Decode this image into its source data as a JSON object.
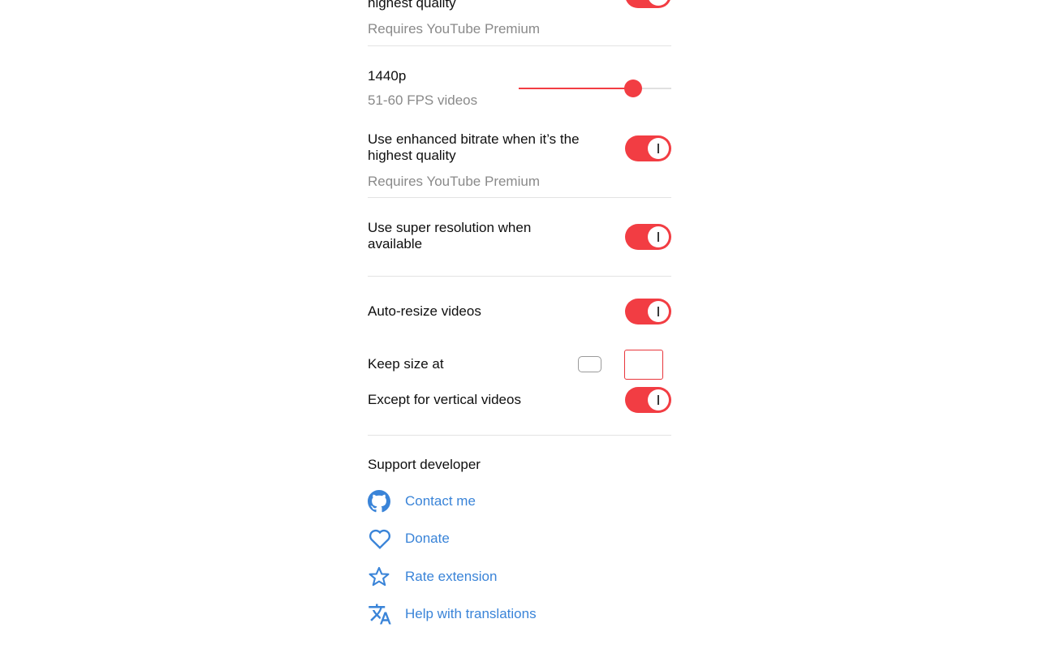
{
  "settings": {
    "top_partial_label": "highest quality",
    "top_partial_sub": "Requires YouTube Premium",
    "resolution": {
      "label": "1440p",
      "sub": "51-60 FPS videos",
      "slider_value": 0.75
    },
    "enhanced_bitrate": {
      "label": "Use enhanced bitrate when it’s the highest quality",
      "sub": "Requires YouTube Premium",
      "enabled": true
    },
    "super_resolution": {
      "label": "Use super resolution when available",
      "enabled": true
    },
    "auto_resize": {
      "label": "Auto-resize videos",
      "enabled": true
    },
    "keep_size": {
      "label": "Keep size at",
      "checked": false,
      "value": ""
    },
    "except_vertical": {
      "label": "Except for vertical videos",
      "enabled": true
    }
  },
  "support": {
    "heading": "Support developer",
    "links": [
      {
        "label": "Contact me",
        "icon": "github-icon"
      },
      {
        "label": "Donate",
        "icon": "heart-icon"
      },
      {
        "label": "Rate extension",
        "icon": "star-icon"
      },
      {
        "label": "Help with translations",
        "icon": "translate-icon"
      }
    ]
  },
  "colors": {
    "accent": "#f23d43",
    "link": "#3a84d8",
    "muted": "#8a8a8a",
    "divider": "#e3e3e3"
  }
}
